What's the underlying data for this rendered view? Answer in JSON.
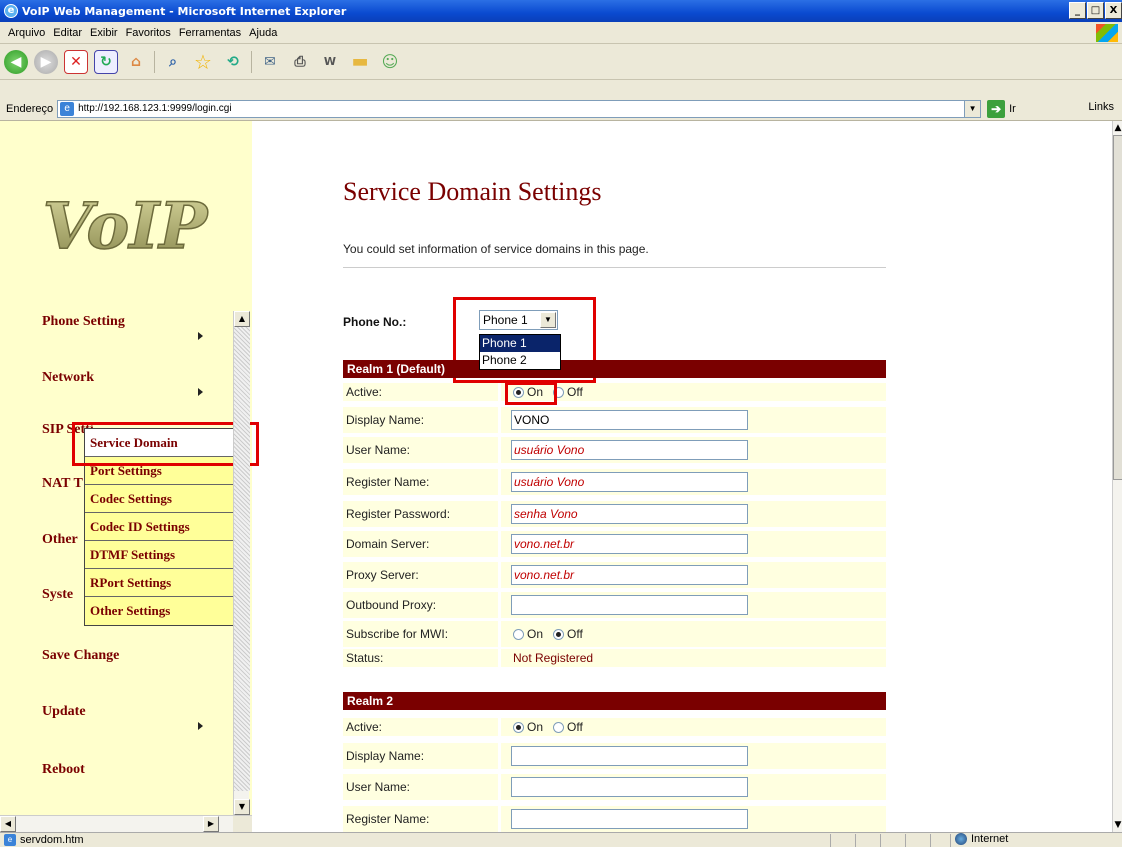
{
  "window": {
    "title": "VoIP Web Management - Microsoft Internet Explorer",
    "buttons": [
      "_",
      "□",
      "X"
    ]
  },
  "menubar": [
    "Arquivo",
    "Editar",
    "Exibir",
    "Favoritos",
    "Ferramentas",
    "Ajuda"
  ],
  "address": {
    "label": "Endereço",
    "url": "http://192.168.123.1:9999/login.cgi",
    "go_label": "Ir",
    "links_label": "Links"
  },
  "sidebar": {
    "logo_text": "VoIP",
    "items": [
      {
        "label": "Phone Setting",
        "has_arrow": true
      },
      {
        "label": "Network",
        "has_arrow": true
      },
      {
        "label": "SIP Setti",
        "has_arrow": false
      },
      {
        "label": "NAT T",
        "has_arrow": false
      },
      {
        "label": "Other",
        "has_arrow": false
      },
      {
        "label": "Syste",
        "has_arrow": false
      },
      {
        "label": "Save Change",
        "has_arrow": false
      },
      {
        "label": "Update",
        "has_arrow": true
      },
      {
        "label": "Reboot",
        "has_arrow": false
      }
    ],
    "submenu": [
      "Service Domain",
      "Port Settings",
      "Codec Settings",
      "Codec ID Settings",
      "DTMF Settings",
      "RPort Settings",
      "Other Settings"
    ],
    "submenu_active": "Service Domain"
  },
  "main": {
    "title": "Service Domain Settings",
    "description": "You could set information of service domains in this page.",
    "phone_no_label": "Phone No.:",
    "phone_selected": "Phone 1",
    "phone_options": [
      "Phone 1",
      "Phone 2"
    ],
    "realm1": {
      "header": "Realm 1 (Default)",
      "active_label": "Active:",
      "on_label": "On",
      "off_label": "Off",
      "active_value": "On",
      "display_name_label": "Display Name:",
      "display_name": "VONO",
      "user_name_label": "User Name:",
      "user_name": "usuário Vono",
      "register_name_label": "Register Name:",
      "register_name": "usuário Vono",
      "register_password_label": "Register Password:",
      "register_password": "senha Vono",
      "domain_server_label": "Domain Server:",
      "domain_server": "vono.net.br",
      "proxy_server_label": "Proxy Server:",
      "proxy_server": "vono.net.br",
      "outbound_proxy_label": "Outbound Proxy:",
      "outbound_proxy": "",
      "mwi_label": "Subscribe for MWI:",
      "mwi_value": "Off",
      "status_label": "Status:",
      "status": "Not Registered"
    },
    "realm2": {
      "header": "Realm 2",
      "active_label": "Active:",
      "on_label": "On",
      "off_label": "Off",
      "active_value": "On",
      "display_name_label": "Display Name:",
      "user_name_label": "User Name:",
      "register_name_label": "Register Name:"
    }
  },
  "statusbar": {
    "file": "servdom.htm",
    "zone": "Internet"
  },
  "colors": {
    "accent": "#7a0000",
    "sidebar_bg": "#ffffcc",
    "highlight": "#e00000"
  }
}
